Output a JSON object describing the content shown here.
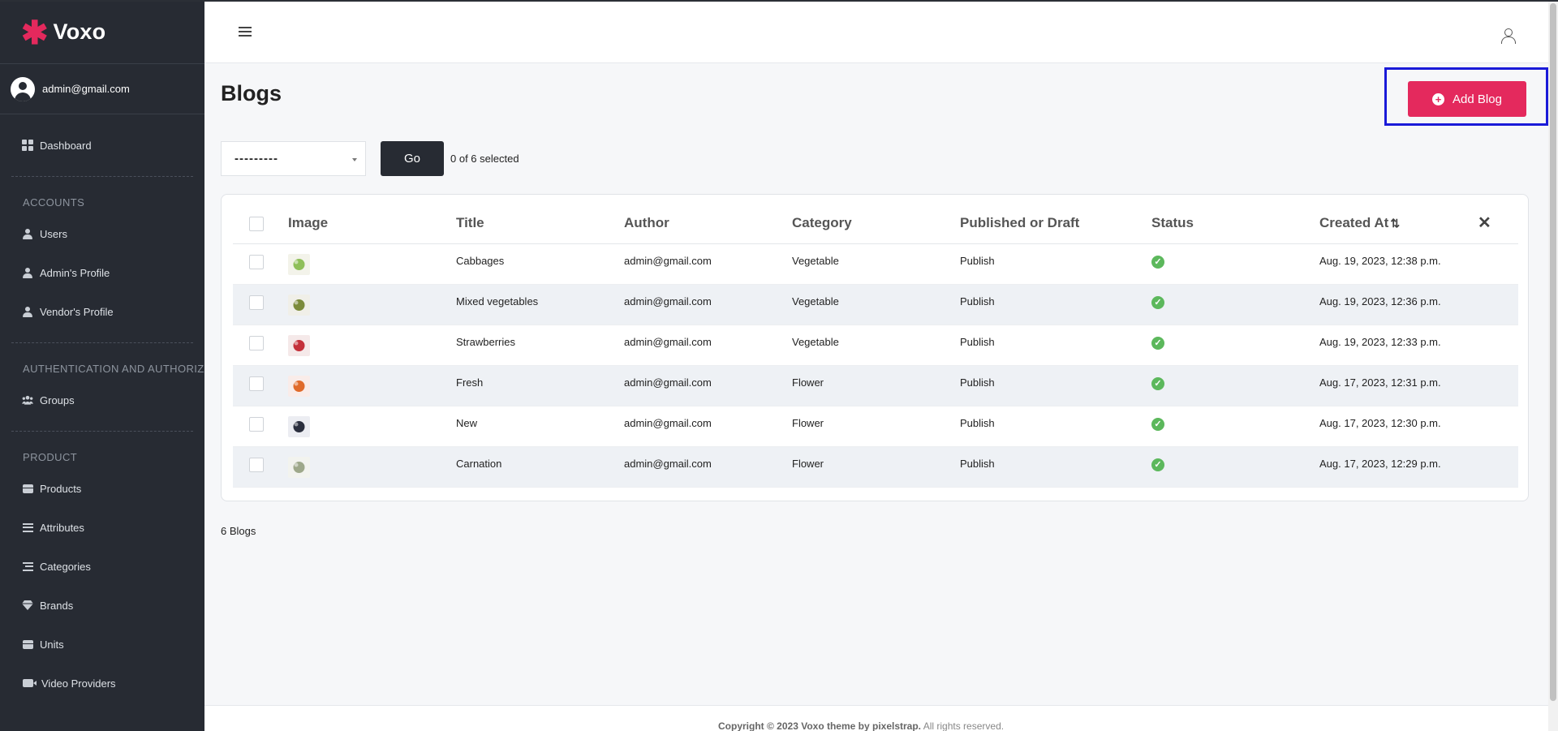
{
  "brand": {
    "name": "Voxo",
    "star": "✱"
  },
  "user": {
    "email": "admin@gmail.com"
  },
  "sidebar": {
    "dashboard": "Dashboard",
    "sections": [
      {
        "title": "ACCOUNTS",
        "items": [
          "Users",
          "Admin's Profile",
          "Vendor's Profile"
        ]
      },
      {
        "title": "AUTHENTICATION AND AUTHORIZATION",
        "items": [
          "Groups"
        ]
      },
      {
        "title": "PRODUCT",
        "items": [
          "Products",
          "Attributes",
          "Categories",
          "Brands",
          "Units",
          "Video Providers"
        ]
      }
    ]
  },
  "page": {
    "title": "Blogs",
    "add_button": "Add Blog",
    "count_text": "6 Blogs"
  },
  "actions": {
    "select_value": "---------",
    "go_label": "Go",
    "selected_text": "0 of 6 selected"
  },
  "table": {
    "columns": [
      "Image",
      "Title",
      "Author",
      "Category",
      "Published or Draft",
      "Status",
      "Created At"
    ],
    "rows": [
      {
        "title": "Cabbages",
        "author": "admin@gmail.com",
        "category": "Vegetable",
        "publish": "Publish",
        "created": "Aug. 19, 2023, 12:38 p.m."
      },
      {
        "title": "Mixed vegetables",
        "author": "admin@gmail.com",
        "category": "Vegetable",
        "publish": "Publish",
        "created": "Aug. 19, 2023, 12:36 p.m."
      },
      {
        "title": "Strawberries",
        "author": "admin@gmail.com",
        "category": "Vegetable",
        "publish": "Publish",
        "created": "Aug. 19, 2023, 12:33 p.m."
      },
      {
        "title": "Fresh",
        "author": "admin@gmail.com",
        "category": "Flower",
        "publish": "Publish",
        "created": "Aug. 17, 2023, 12:31 p.m."
      },
      {
        "title": "New",
        "author": "admin@gmail.com",
        "category": "Flower",
        "publish": "Publish",
        "created": "Aug. 17, 2023, 12:30 p.m."
      },
      {
        "title": "Carnation",
        "author": "admin@gmail.com",
        "category": "Flower",
        "publish": "Publish",
        "created": "Aug. 17, 2023, 12:29 p.m."
      }
    ]
  },
  "footer": {
    "copyright": "Copyright © 2023 Voxo theme by pixelstrap.",
    "rights": " All rights reserved."
  },
  "colors": {
    "accent": "#e4295d",
    "sidebar_bg": "#272b33",
    "highlight": "#1a1ad8",
    "status_ok": "#5cb85c"
  }
}
